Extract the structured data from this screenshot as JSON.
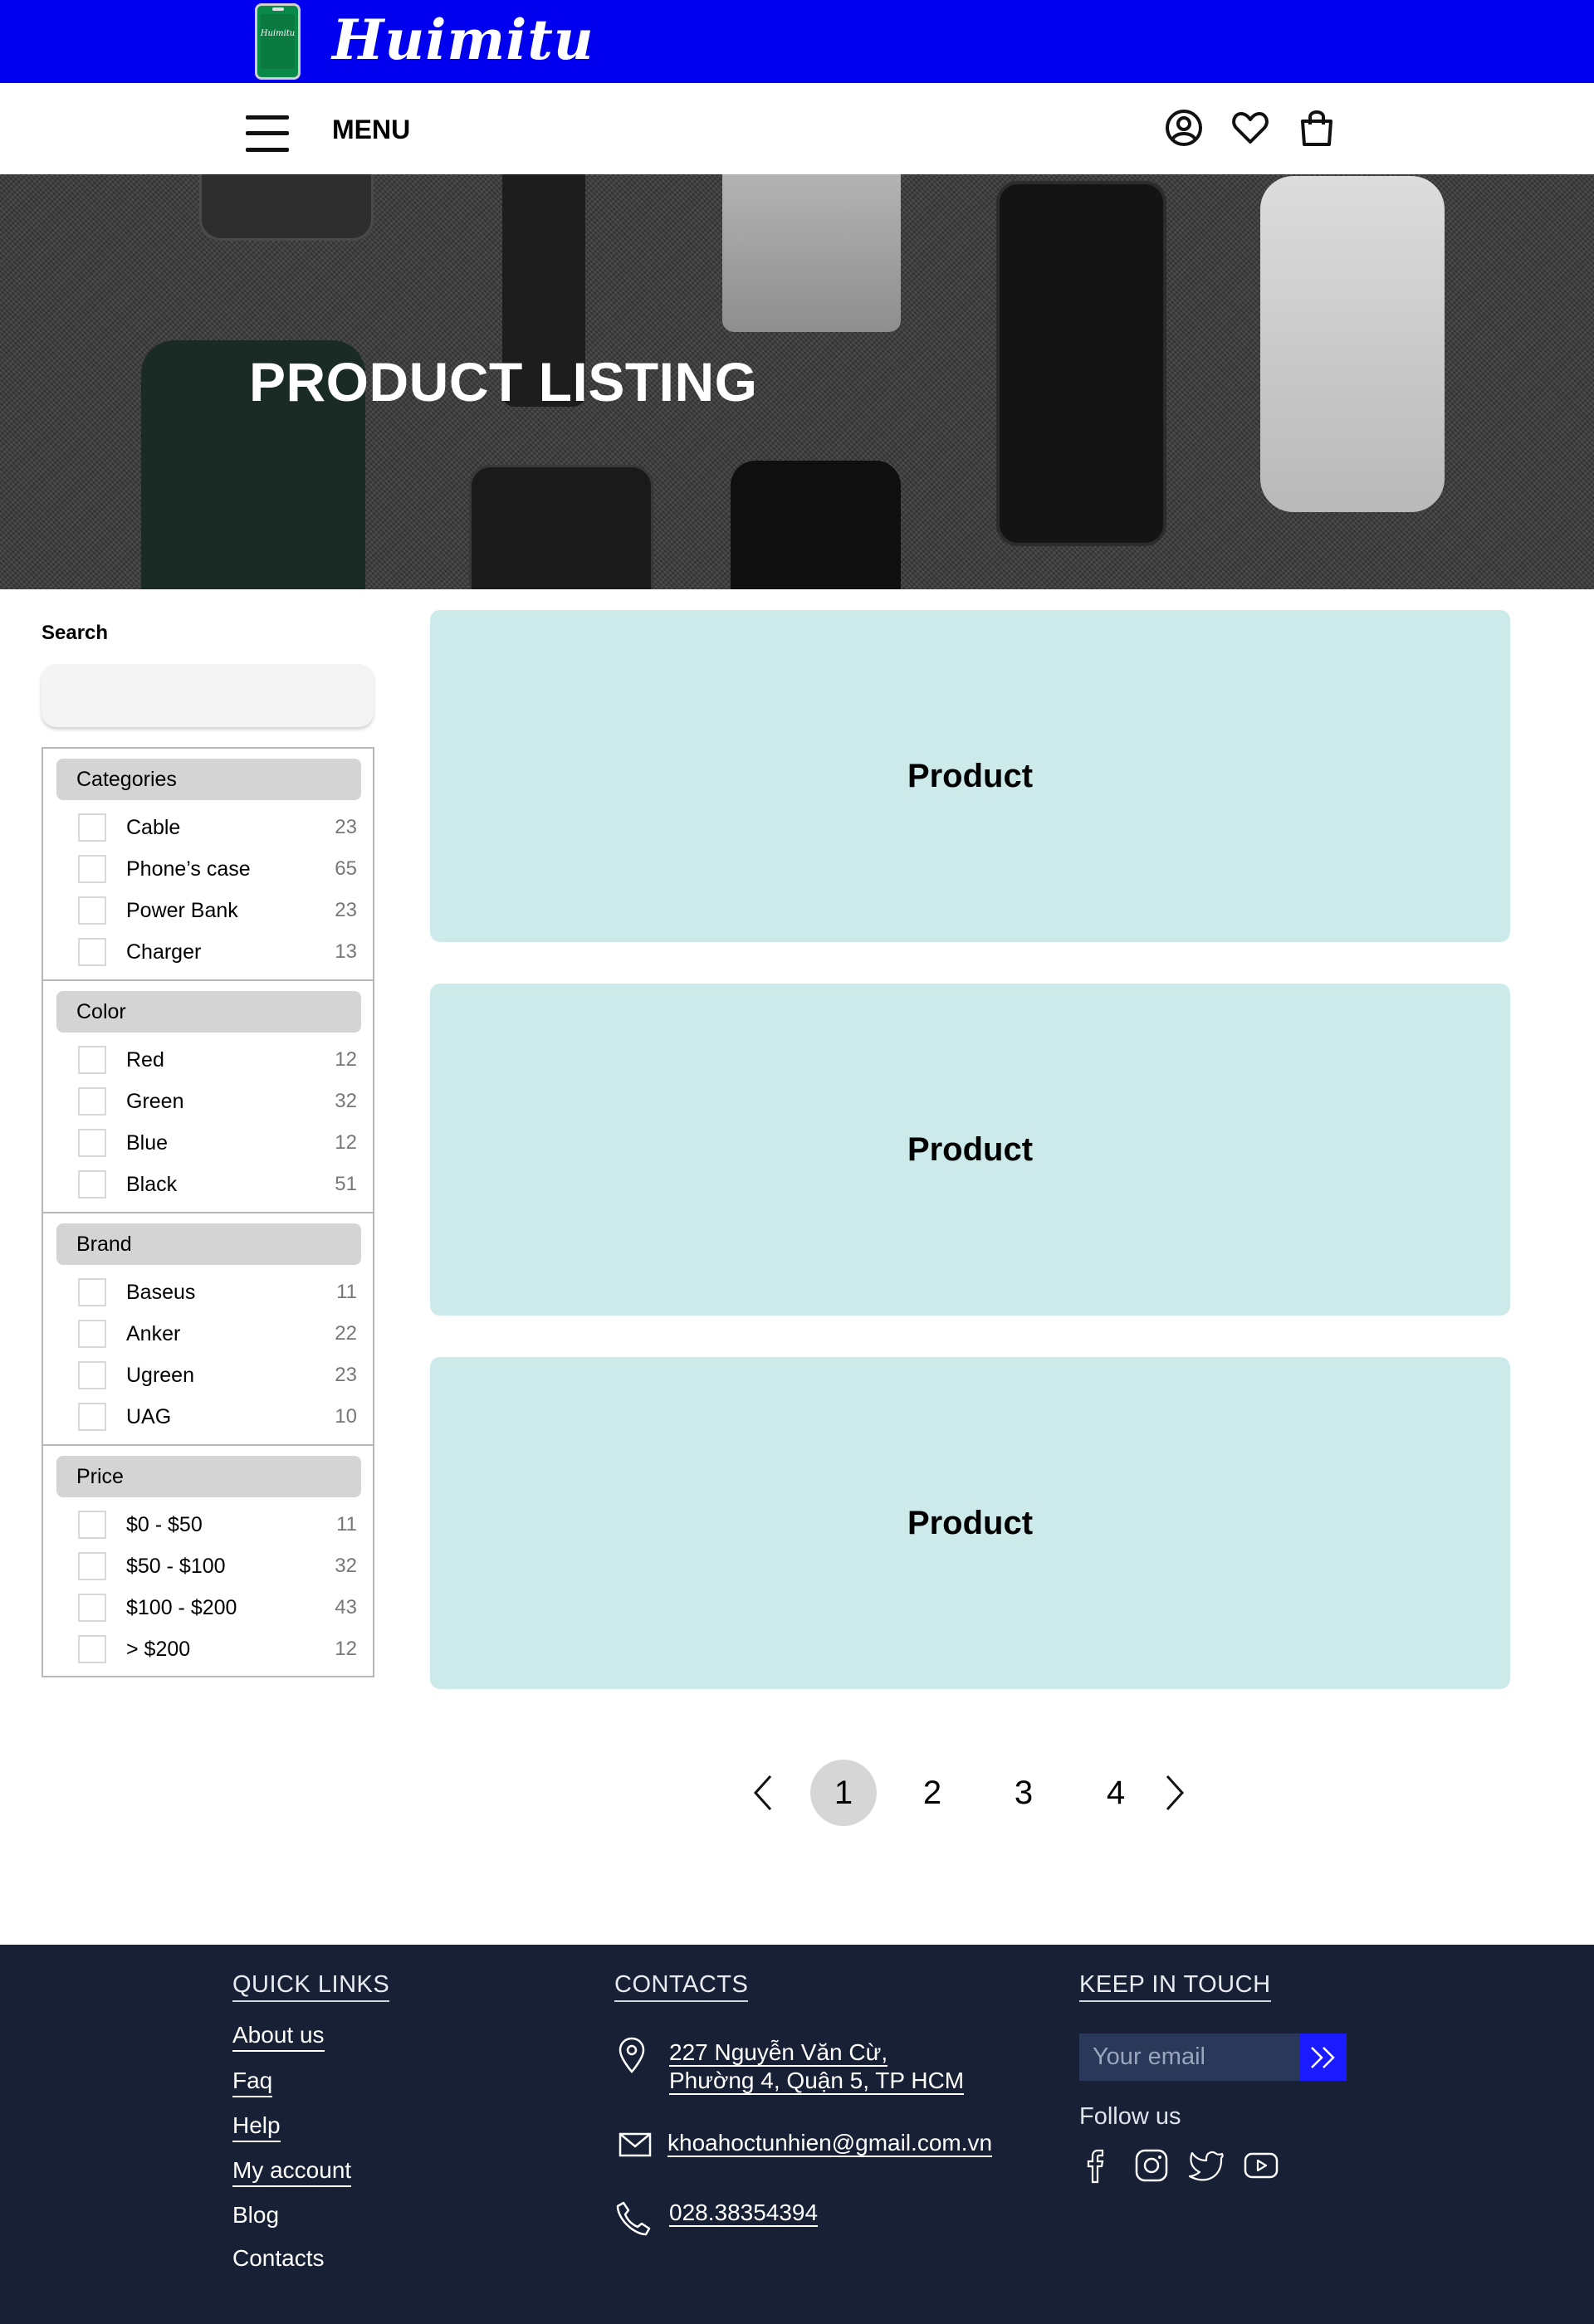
{
  "brand": {
    "name": "Huimitu",
    "logo_text": "Huimitu",
    "color": "#0000ee"
  },
  "menu": {
    "label": "MENU",
    "icons": [
      "user-icon",
      "heart-icon",
      "shopping-bag-icon"
    ]
  },
  "hero": {
    "title": "PRODUCT LISTING"
  },
  "sidebar": {
    "search_label": "Search",
    "search_value": "",
    "groups": [
      {
        "title": "Categories",
        "items": [
          {
            "label": "Cable",
            "count": "23"
          },
          {
            "label": "Phone’s case",
            "count": "65"
          },
          {
            "label": "Power Bank",
            "count": "23"
          },
          {
            "label": "Charger",
            "count": "13"
          }
        ]
      },
      {
        "title": "Color",
        "items": [
          {
            "label": "Red",
            "count": "12"
          },
          {
            "label": "Green",
            "count": "32"
          },
          {
            "label": "Blue",
            "count": "12"
          },
          {
            "label": "Black",
            "count": "51"
          }
        ]
      },
      {
        "title": "Brand",
        "items": [
          {
            "label": "Baseus",
            "count": "11"
          },
          {
            "label": "Anker",
            "count": "22"
          },
          {
            "label": "Ugreen",
            "count": "23"
          },
          {
            "label": "UAG",
            "count": "10"
          }
        ]
      },
      {
        "title": "Price",
        "items": [
          {
            "label": "$0 - $50",
            "count": "11"
          },
          {
            "label": "$50 - $100",
            "count": "32"
          },
          {
            "label": "$100 - $200",
            "count": "43"
          },
          {
            "label": "> $200",
            "count": "12"
          }
        ]
      }
    ]
  },
  "products": [
    {
      "label": "Product"
    },
    {
      "label": "Product"
    },
    {
      "label": "Product"
    }
  ],
  "pagination": {
    "pages": [
      "1",
      "2",
      "3",
      "4"
    ],
    "current": "1"
  },
  "footer": {
    "quick_links_title": "QUICK LINKS",
    "quick_links": [
      "About us",
      "Faq",
      "Help",
      "My account",
      "Blog",
      "Contacts"
    ],
    "contacts_title": "CONTACTS",
    "address_line1": "227 Nguyễn Văn Cừ,",
    "address_line2": "Phường 4, Quận 5, TP HCM",
    "email": "khoahoctunhien@gmail.com.vn",
    "phone": "028.38354394",
    "keep_in_touch_title": "KEEP IN TOUCH",
    "email_placeholder": "Your email",
    "follow_us": "Follow us",
    "social_icons": [
      "facebook-icon",
      "instagram-icon",
      "twitter-icon",
      "youtube-icon"
    ],
    "background": "#172034"
  }
}
